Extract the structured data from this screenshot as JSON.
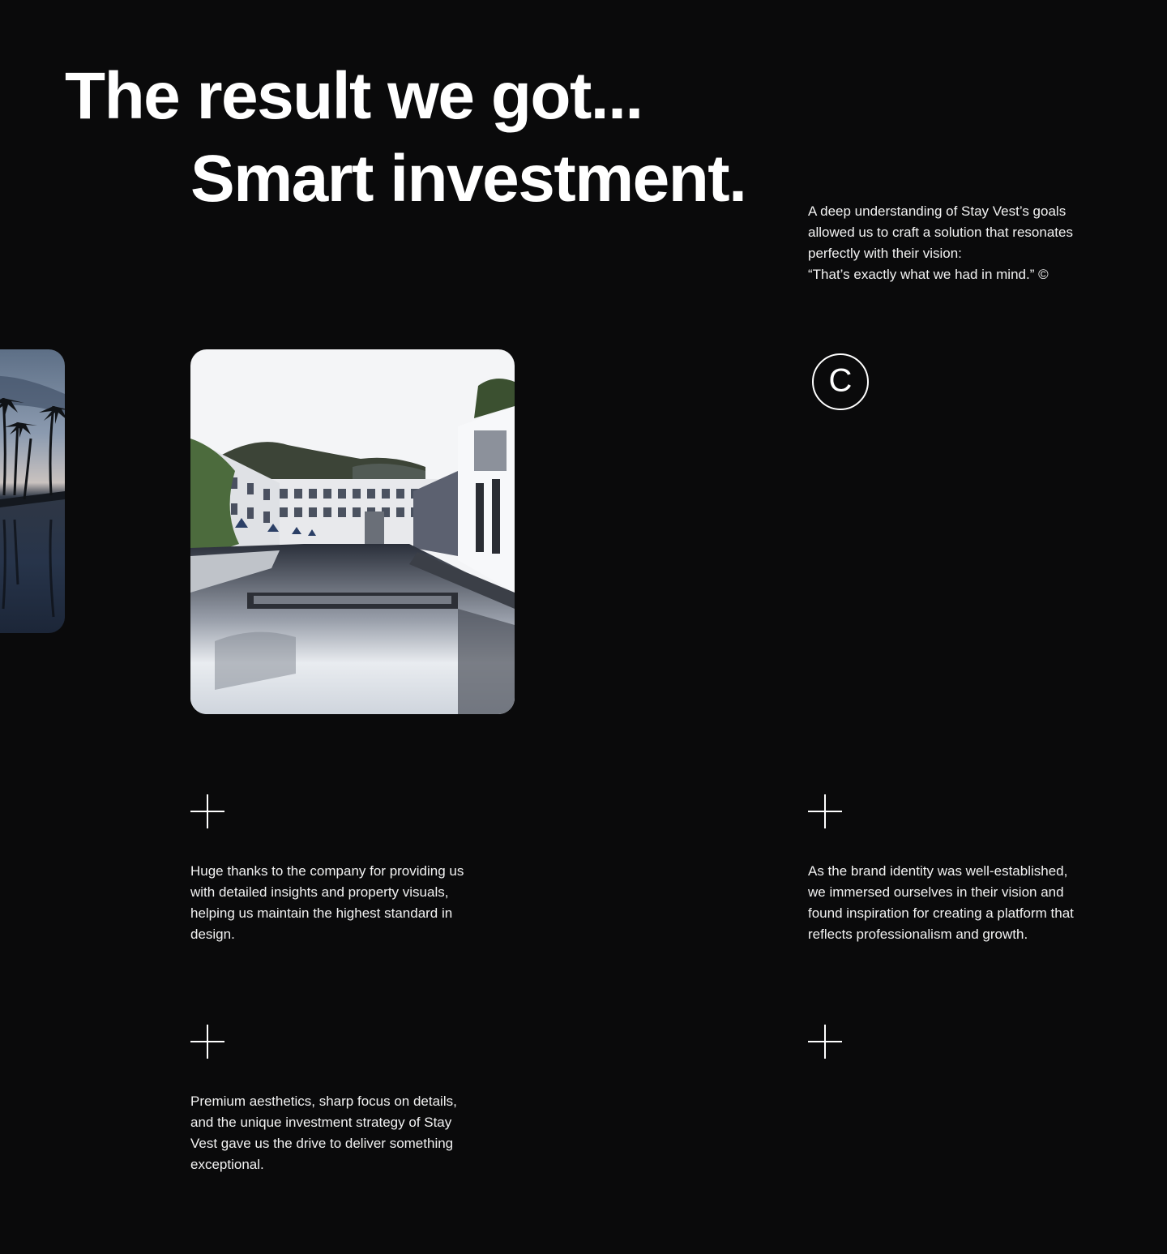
{
  "hero": {
    "headline_line1": "The result we got...",
    "headline_line2": "Smart investment."
  },
  "intro": {
    "quote": "A deep understanding of Stay Vest’s goals\nallowed us to craft a solution that resonates\nperfectly with their vision:\n“That’s exactly what we had in mind.” ©"
  },
  "gallery": {
    "left_photo": "palm-pool-photo",
    "main_photo": "resort-pool-photo"
  },
  "badge": {
    "icon": "copyright-circle-icon",
    "glyph": "C"
  },
  "features": [
    {
      "icon": "plus-icon",
      "text": "Huge thanks to the company for providing us\nwith detailed insights and property visuals,\nhelping us maintain the highest standard in\ndesign."
    },
    {
      "icon": "plus-icon",
      "text": "As the brand identity was well-established,\nwe immersed ourselves in their vision and\nfound inspiration for creating a platform that\nreflects professionalism and growth."
    },
    {
      "icon": "plus-icon",
      "text": "Premium aesthetics, sharp focus on details,\nand the unique investment strategy of Stay\nVest gave us the drive to deliver something\nexceptional."
    },
    {
      "icon": "plus-icon",
      "text": ""
    }
  ],
  "colors": {
    "background": "#0a0a0b",
    "text": "#ffffff"
  }
}
